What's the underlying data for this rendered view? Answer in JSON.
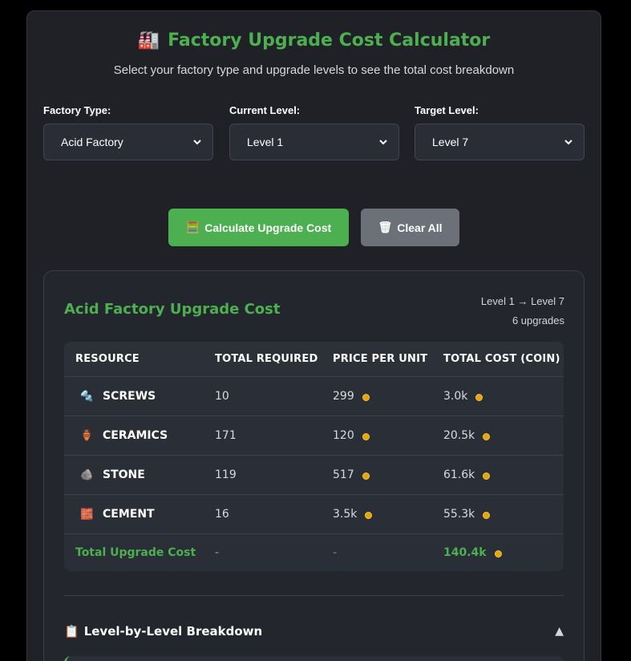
{
  "header": {
    "icon": "factory-icon",
    "title": "Factory Upgrade Cost Calculator",
    "subtitle": "Select your factory type and upgrade levels to see the total cost breakdown"
  },
  "form": {
    "factory_type": {
      "label": "Factory Type:",
      "value": "Acid Factory"
    },
    "current_level": {
      "label": "Current Level:",
      "value": "Level 1"
    },
    "target_level": {
      "label": "Target Level:",
      "value": "Level 7"
    }
  },
  "buttons": {
    "calculate": {
      "icon": "abacus-icon",
      "label": "Calculate Upgrade Cost"
    },
    "clear": {
      "icon": "trash-icon",
      "label": "Clear All"
    }
  },
  "results": {
    "title": "Acid Factory Upgrade Cost",
    "range": "Level 1 → Level 7",
    "upgrades": "6 upgrades",
    "columns": [
      "Resource",
      "Total Required",
      "Price Per Unit",
      "Total Cost (Coin)"
    ],
    "rows": [
      {
        "icon": "screw-icon",
        "name": "Screws",
        "required": "10",
        "price": "299",
        "total": "3.0k"
      },
      {
        "icon": "ceramic-vase-icon",
        "name": "Ceramics",
        "required": "171",
        "price": "120",
        "total": "20.5k"
      },
      {
        "icon": "rock-icon",
        "name": "Stone",
        "required": "119",
        "price": "517",
        "total": "61.6k"
      },
      {
        "icon": "cement-bag-icon",
        "name": "Cement",
        "required": "16",
        "price": "3.5k",
        "total": "55.3k"
      }
    ],
    "total_row": {
      "label": "Total Upgrade Cost",
      "required": "-",
      "price": "-",
      "total": "140.4k"
    },
    "coin_color": "#e5a50a",
    "accent_color": "#4caf50"
  },
  "breakdown": {
    "icon": "clipboard-icon",
    "label": "Level-by-Level Breakdown",
    "toggle_icon": "collapse-up-icon"
  }
}
